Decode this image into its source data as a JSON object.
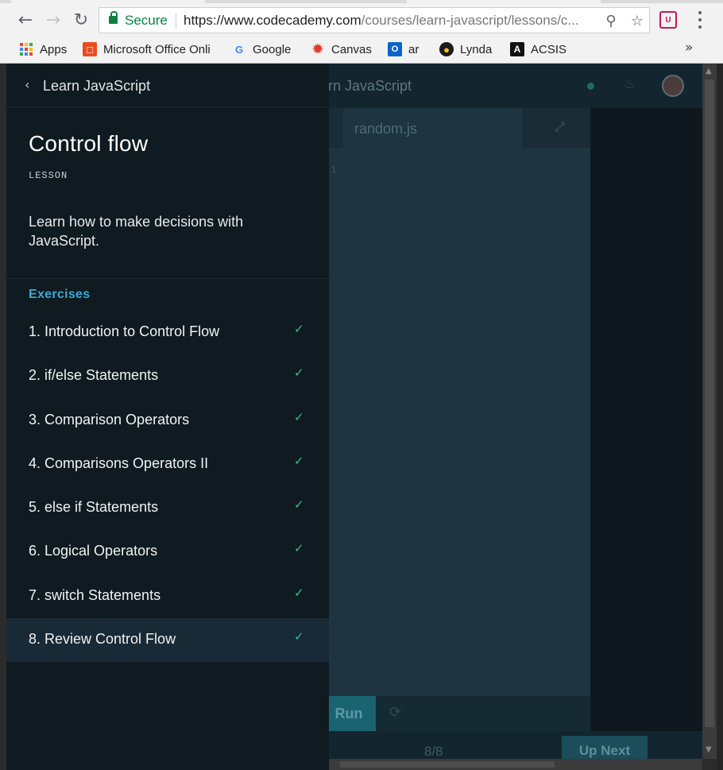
{
  "browser": {
    "secure_label": "Secure",
    "url_host": "https://www.codecademy.com",
    "url_path": "/courses/learn-javascript/lessons/c...",
    "extension_label": "U",
    "bookmarks": [
      {
        "label": "Apps",
        "icon": "apps-grid-icon"
      },
      {
        "label": "Microsoft Office Onli",
        "icon": "office-icon"
      },
      {
        "label": "Google",
        "icon": "google-icon"
      },
      {
        "label": "Canvas",
        "icon": "canvas-icon"
      },
      {
        "label": "ar",
        "icon": "outlook-icon"
      },
      {
        "label": "Lynda",
        "icon": "lynda-icon"
      },
      {
        "label": "ACSIS",
        "icon": "acsis-icon"
      }
    ],
    "more_label": "»"
  },
  "background": {
    "course_title": "arn JavaScript",
    "file_tab": "random.js",
    "line_number": "1",
    "run_label": "Run",
    "progress": "8/8",
    "up_next_label": "Up Next"
  },
  "sidebar": {
    "back_label": "Learn JavaScript",
    "lesson_title": "Control flow",
    "kicker": "LESSON",
    "description": "Learn how to make decisions with JavaScript.",
    "section_title": "Exercises",
    "exercises": [
      {
        "label": "1. Introduction to Control Flow",
        "completed": true,
        "active": false
      },
      {
        "label": "2. if/else Statements",
        "completed": true,
        "active": false
      },
      {
        "label": "3. Comparison Operators",
        "completed": true,
        "active": false
      },
      {
        "label": "4. Comparisons Operators II",
        "completed": true,
        "active": false
      },
      {
        "label": "5. else if Statements",
        "completed": true,
        "active": false
      },
      {
        "label": "6. Logical Operators",
        "completed": true,
        "active": false
      },
      {
        "label": "7. switch Statements",
        "completed": true,
        "active": false
      },
      {
        "label": "8. Review Control Flow",
        "completed": true,
        "active": true
      }
    ]
  },
  "colors": {
    "accent": "#3ca9d2",
    "check": "#3fb7a0",
    "sidebar_bg": "#0f1b21",
    "secure": "#0b8043"
  }
}
